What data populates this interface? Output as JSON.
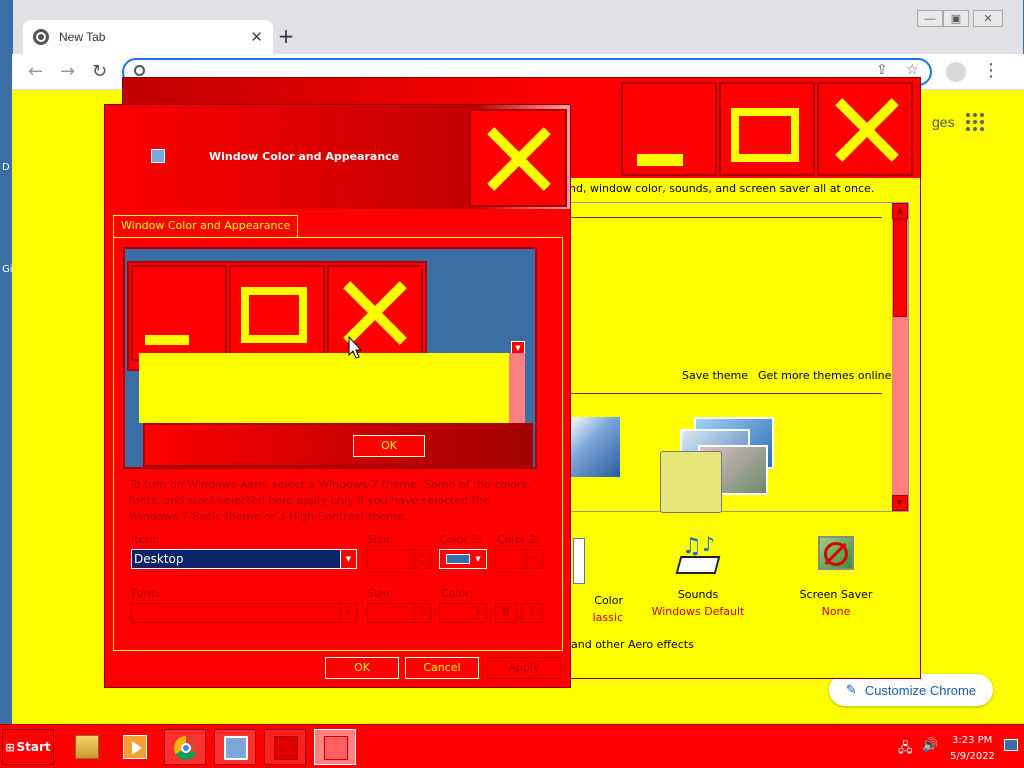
{
  "browser": {
    "tab_title": "New Tab",
    "tab_close": "✕",
    "new_tab": "+",
    "images_link": "ges",
    "customize_label": "Customize Chrome",
    "edge_letters": [
      "D",
      "Gi"
    ]
  },
  "personalization": {
    "intro_text": "nd, window color, sounds, and screen saver all at once.",
    "save_theme": "Save theme",
    "get_more_themes": "Get more themes online",
    "window_color": {
      "title": "Color",
      "sub": "lassic"
    },
    "sounds": {
      "title": "Sounds",
      "sub": "Windows Default"
    },
    "screen_saver": {
      "title": "Screen Saver",
      "sub": "None"
    },
    "aero_text": "and other Aero effects"
  },
  "dialog": {
    "title": "Window Color and Appearance",
    "tab_label": "Window Color and Appearance",
    "preview_ok": "OK",
    "instructions": "To turn on Windows Aero, select a Windows 7 theme.  Some of the colors, fonts, and sizes selected here apply only if you have selected the Windows 7 Basic theme or a High Contrast theme.",
    "labels": {
      "item": "Item:",
      "size": "Size:",
      "color1": "Color 1:",
      "color2": "Color 2:",
      "font": "Font:",
      "font_size": "Size:",
      "font_color": "Color:",
      "bold": "B",
      "italic": "I"
    },
    "item_value": "Desktop",
    "buttons": {
      "ok": "OK",
      "cancel": "Cancel",
      "apply": "Apply"
    }
  },
  "taskbar": {
    "start": "Start",
    "time": "3:23 PM",
    "date": "5/9/2022"
  },
  "colors": {
    "theme_red": "#ff0000",
    "theme_yellow": "#ffff00",
    "desktop_blue": "#3a6ea5"
  }
}
